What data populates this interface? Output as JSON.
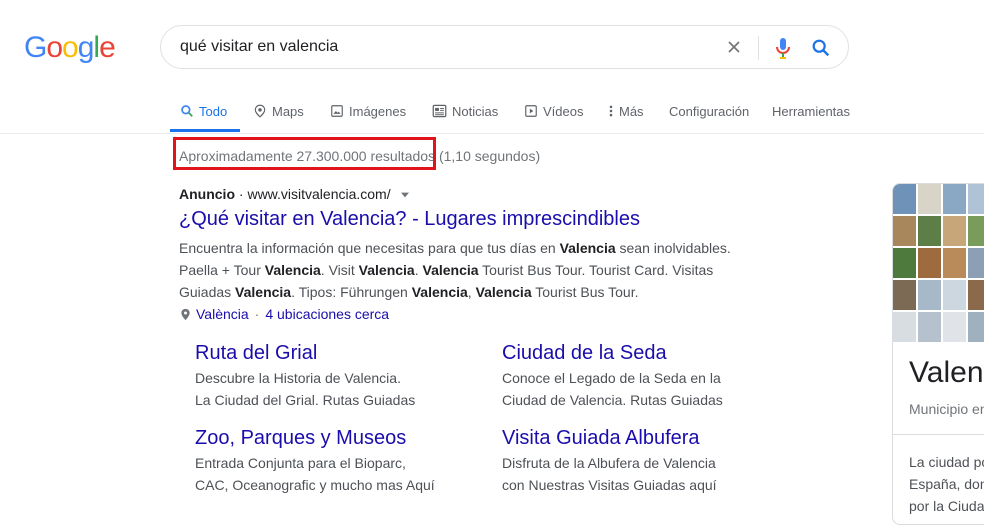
{
  "logo": {
    "letters": [
      "G",
      "o",
      "o",
      "g",
      "l",
      "e"
    ],
    "colors": [
      "#4285f4",
      "#ea4335",
      "#fbbc05",
      "#4285f4",
      "#34a853",
      "#ea4335"
    ]
  },
  "search": {
    "query": "qué visitar en valencia"
  },
  "tabs": [
    {
      "label": "Todo",
      "icon": "search-icon",
      "active": true
    },
    {
      "label": "Maps",
      "icon": "map-pin-icon"
    },
    {
      "label": "Imágenes",
      "icon": "image-icon"
    },
    {
      "label": "Noticias",
      "icon": "news-icon"
    },
    {
      "label": "Vídeos",
      "icon": "play-icon"
    },
    {
      "label": "Más",
      "icon": "more-vert-icon"
    },
    {
      "label": "Configuración"
    },
    {
      "label": "Herramientas"
    }
  ],
  "stats": {
    "results": "Aproximadamente 27.300.000 resultados",
    "time": "(1,10 segundos)"
  },
  "ad": {
    "label": "Anuncio",
    "url": "www.visitvalencia.com/",
    "title": "¿Qué visitar en Valencia? - Lugares imprescindibles",
    "desc_line1_a": "Encuentra la información que necesitas para que tus días en ",
    "desc_bold": "Valencia",
    "desc_line1_b": " sean inolvidables.",
    "desc_line2": "Paella + Tour Valencia. Visit Valencia. Valencia Tourist Bus Tour. Tourist Card. Visitas",
    "desc_line3": "Guiadas Valencia. Tipos: Führungen Valencia, Valencia Tourist Bus Tour.",
    "location": "València",
    "location_sep": "·",
    "locations_more": "4 ubicaciones cerca"
  },
  "sitelinks": [
    {
      "title": "Ruta del Grial",
      "desc1": "Descubre la Historia de Valencia.",
      "desc2": "La Ciudad del Grial. Rutas Guiadas"
    },
    {
      "title": "Ciudad de la Seda",
      "desc1": "Conoce el Legado de la Seda en la",
      "desc2": "Ciudad de Valencia. Rutas Guiadas"
    },
    {
      "title": "Zoo, Parques y Museos",
      "desc1": "Entrada Conjunta para el Bioparc,",
      "desc2": "CAC, Oceanografic y mucho mas Aquí"
    },
    {
      "title": "Visita Guiada Albufera",
      "desc1": "Disfruta de la Albufera de Valencia",
      "desc2": "con Nuestras Visitas Guiadas aquí"
    }
  ],
  "knowledge_panel": {
    "title": "Valenc",
    "subtitle": "Municipio en",
    "desc1": "La ciudad po",
    "desc2": "España, don",
    "desc3": "por la Ciuda"
  },
  "colors": {
    "link": "#1a0dab",
    "accent": "#1a73e8",
    "highlight_box": "#e2141b"
  }
}
